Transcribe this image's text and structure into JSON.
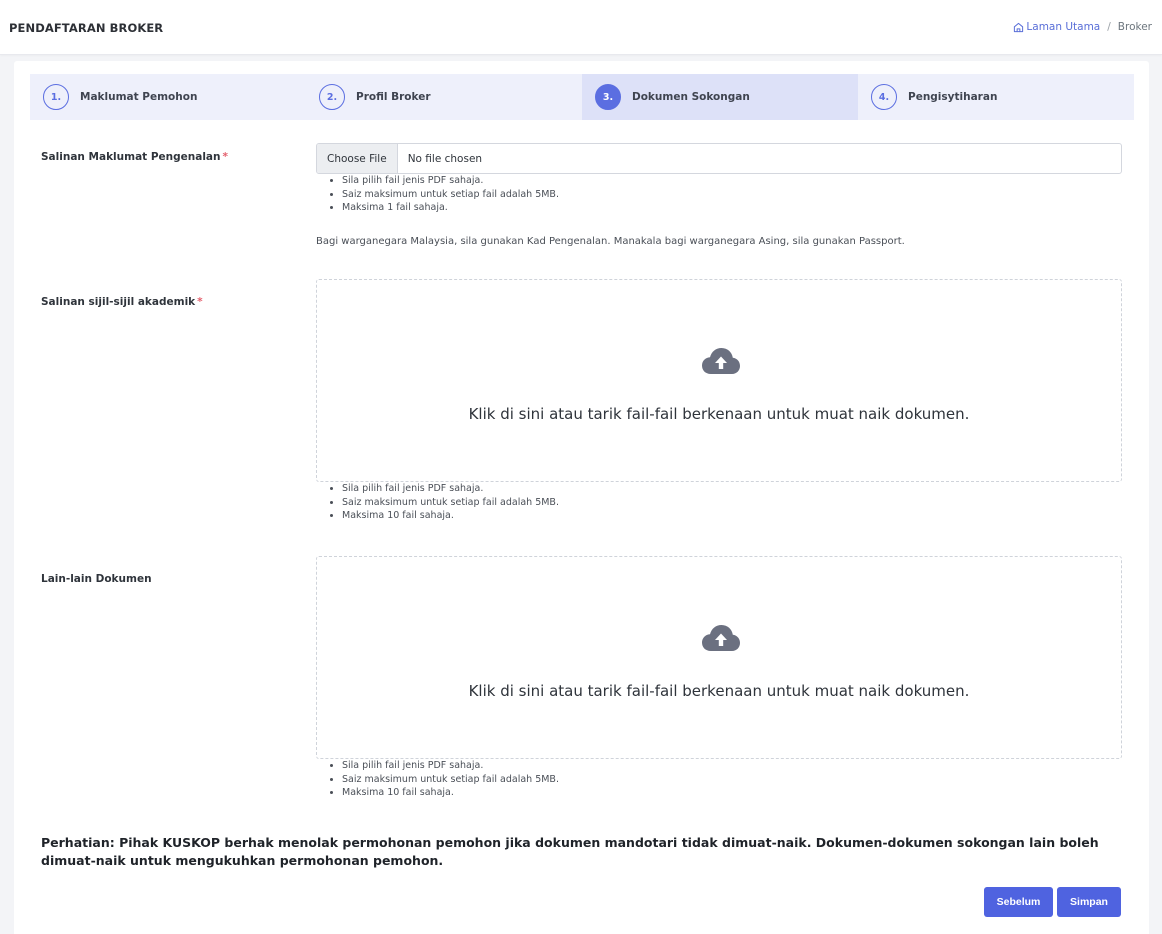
{
  "header": {
    "title": "PENDAFTARAN BROKER",
    "breadcrumb_home": "Laman Utama",
    "breadcrumb_separator": "/",
    "breadcrumb_current": "Broker"
  },
  "steps": [
    {
      "number": "1.",
      "label": "Maklumat Pemohon",
      "active": false
    },
    {
      "number": "2.",
      "label": "Profil Broker",
      "active": false
    },
    {
      "number": "3.",
      "label": "Dokumen Sokongan",
      "active": true
    },
    {
      "number": "4.",
      "label": "Pengisytiharan",
      "active": false
    }
  ],
  "fields": {
    "ic": {
      "label": "Salinan Maklumat Pengenalan",
      "required_mark": "*",
      "choose_button": "Choose File",
      "file_status": "No file chosen",
      "hints": [
        "Sila pilih fail jenis PDF sahaja.",
        "Saiz maksimum untuk setiap fail adalah 5MB.",
        "Maksima 1 fail sahaja."
      ],
      "note": "Bagi warganegara Malaysia, sila gunakan Kad Pengenalan. Manakala bagi warganegara Asing, sila gunakan Passport."
    },
    "academic": {
      "label": "Salinan sijil-sijil akademik",
      "required_mark": "*",
      "dropzone_text": "Klik di sini atau tarik fail-fail berkenaan untuk muat naik dokumen.",
      "hints": [
        "Sila pilih fail jenis PDF sahaja.",
        "Saiz maksimum untuk setiap fail adalah 5MB.",
        "Maksima 10 fail sahaja."
      ]
    },
    "others": {
      "label": "Lain-lain Dokumen",
      "dropzone_text": "Klik di sini atau tarik fail-fail berkenaan untuk muat naik dokumen.",
      "hints": [
        "Sila pilih fail jenis PDF sahaja.",
        "Saiz maksimum untuk setiap fail adalah 5MB.",
        "Maksima 10 fail sahaja."
      ]
    }
  },
  "warning": "Perhatian: Pihak KUSKOP berhak menolak permohonan pemohon jika dokumen mandotari tidak dimuat-naik. Dokumen-dokumen sokongan lain boleh dimuat-naik untuk mengukuhkan permohonan pemohon.",
  "buttons": {
    "previous": "Sebelum",
    "save": "Simpan"
  },
  "colors": {
    "primary": "#4f63e0",
    "step_bg": "#eef0fb",
    "step_active_bg": "#dde1f8",
    "required": "#e4606d",
    "upload_icon": "#6b7080"
  },
  "icons": {
    "breadcrumb_home": "home-icon",
    "dropzone": "cloud-upload-icon"
  }
}
